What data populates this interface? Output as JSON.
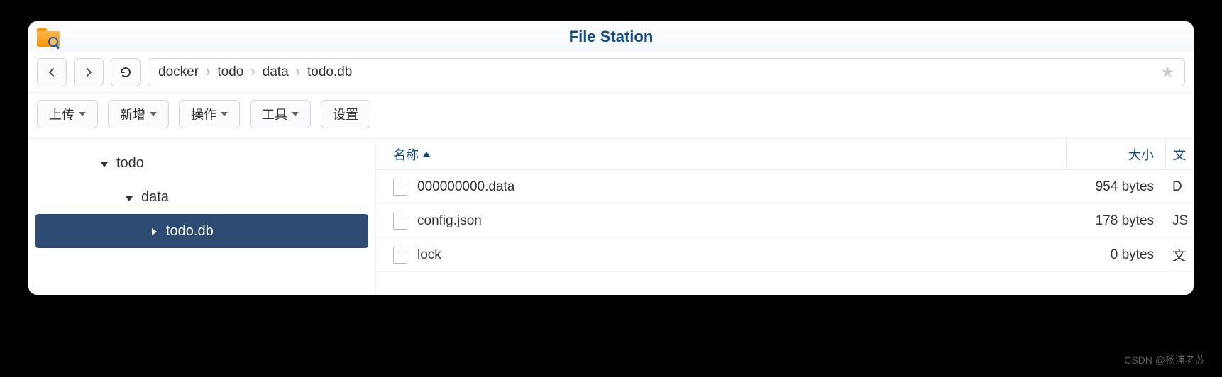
{
  "app": {
    "title": "File Station"
  },
  "breadcrumb": [
    "docker",
    "todo",
    "data",
    "todo.db"
  ],
  "toolbar": {
    "upload": "上传",
    "create": "新增",
    "action": "操作",
    "tools": "工具",
    "settings": "设置"
  },
  "tree": [
    {
      "label": "todo",
      "depth": 1,
      "expanded": true,
      "selected": false
    },
    {
      "label": "data",
      "depth": 2,
      "expanded": true,
      "selected": false
    },
    {
      "label": "todo.db",
      "depth": 3,
      "expanded": false,
      "selected": true
    }
  ],
  "columns": {
    "name": "名称",
    "size": "大小",
    "type": "文"
  },
  "files": [
    {
      "name": "000000000.data",
      "size": "954 bytes",
      "type": "D"
    },
    {
      "name": "config.json",
      "size": "178 bytes",
      "type": "JS"
    },
    {
      "name": "lock",
      "size": "0 bytes",
      "type": "文"
    }
  ],
  "watermark": "CSDN @杨浦老苏"
}
